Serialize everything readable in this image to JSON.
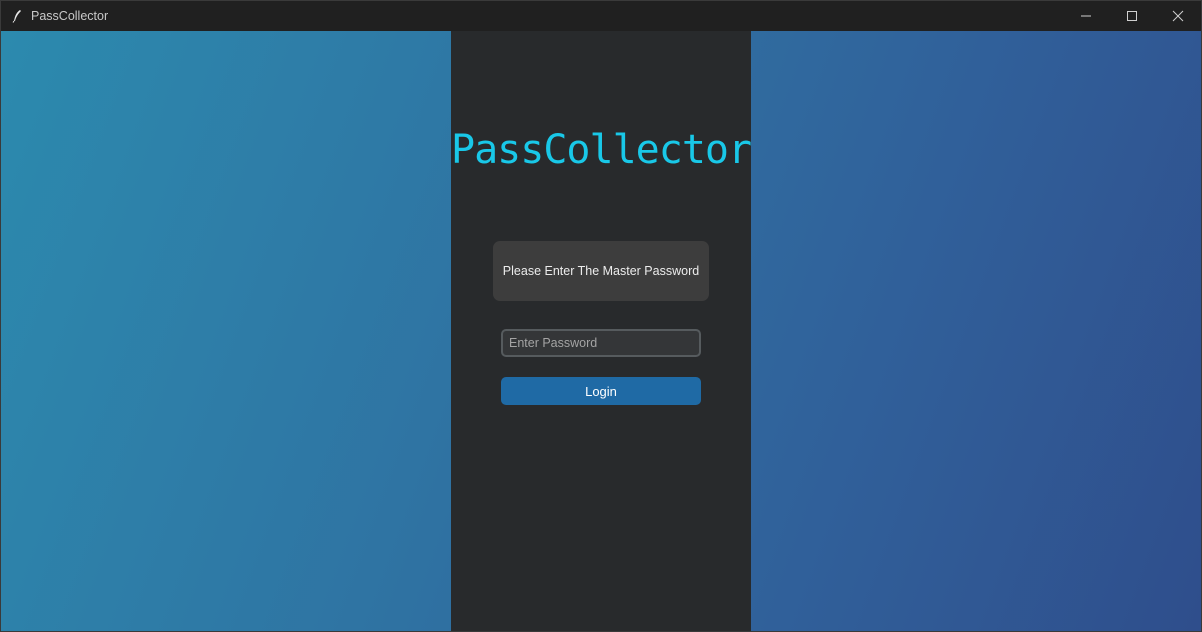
{
  "window": {
    "title": "PassCollector",
    "app_icon": "feather-icon",
    "controls": {
      "minimize_icon": "minimize-icon",
      "maximize_icon": "maximize-icon",
      "close_icon": "close-icon"
    }
  },
  "login": {
    "app_title": "PassCollector",
    "prompt": "Please Enter The Master Password",
    "password_placeholder": "Enter Password",
    "password_value": "",
    "login_label": "Login"
  },
  "colors": {
    "title_accent": "#19c8e8",
    "panel_bg": "#282a2c",
    "button_bg": "#1f6aa5",
    "gradient_start": "#2c8aae",
    "gradient_end": "#2f4e8c"
  }
}
